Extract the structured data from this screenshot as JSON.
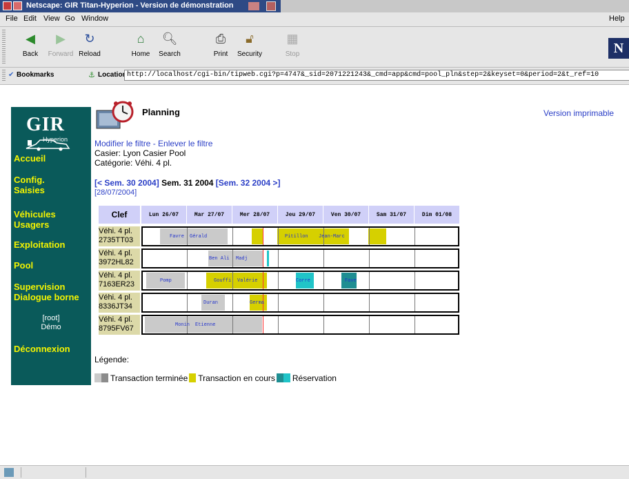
{
  "window": {
    "title": "Netscape: GIR Titan-Hyperion - Version de démonstration"
  },
  "menu": {
    "items": [
      "File",
      "Edit",
      "View",
      "Go",
      "Window"
    ],
    "help": "Help"
  },
  "toolbar": {
    "back": "Back",
    "forward": "Forward",
    "reload": "Reload",
    "home": "Home",
    "search": "Search",
    "print": "Print",
    "security": "Security",
    "stop": "Stop"
  },
  "location": {
    "bookmarks": "Bookmarks",
    "label": "Location:",
    "url": "http://localhost/cgi-bin/tipweb.cgi?p=4747&_sid=2071221243&_cmd=app&cmd=pool_pln&step=2&keyset=0&period=2&t_ref=10"
  },
  "sidebar": {
    "logo": "GIR",
    "logo_sub": "Hyperion",
    "nav": [
      "Accueil",
      "Config.\nSaisies",
      "Véhicules\nUsagers",
      "Exploitation",
      "Pool",
      "Supervision\nDialogue borne",
      "Déconnexion"
    ],
    "user_line1": "[root]",
    "user_line2": "Démo"
  },
  "page": {
    "title": "Planning",
    "print_version": "Version imprimable",
    "modify_filter": "Modifier le filtre",
    "separator": " - ",
    "remove_filter": "Enlever le filtre",
    "casier": "Casier: Lyon Casier Pool",
    "categorie": "Catégorie: Véhi. 4 pl.",
    "prev_week": "[< Sem. 30 2004]",
    "current_week": " Sem. 31 2004 ",
    "next_week": "[Sem. 32 2004 >]",
    "date": "[28/07/2004]"
  },
  "grid": {
    "clef": "Clef",
    "days": [
      "Lun 26/07",
      "Mar 27/07",
      "Mer 28/07",
      "Jeu 29/07",
      "Ven 30/07",
      "Sam 31/07",
      "Dim 01/08"
    ],
    "rows": [
      {
        "vehicle": "Véhi. 4 pl.\n2735TT03"
      },
      {
        "vehicle": "Véhi. 4 pl.\n3972HL82"
      },
      {
        "vehicle": "Véhi. 4 pl.\n7163ER23"
      },
      {
        "vehicle": "Véhi. 4 pl.\n8336JT34"
      },
      {
        "vehicle": "Véhi. 4 pl.\n8795FV67"
      }
    ],
    "labels": {
      "r0": [
        "Favre",
        "Gérald",
        "Pitillon",
        "Jean-Marc"
      ],
      "r1": [
        "Ben Ali",
        "Madj"
      ],
      "r2": [
        "Pomp",
        "Gouffi",
        "Valérie",
        "Corre",
        "Fave"
      ],
      "r3": [
        "Duran",
        "Germa"
      ],
      "r4": [
        "Monin",
        "Etienne"
      ]
    }
  },
  "legend": {
    "title": "Légende:",
    "done": "Transaction terminée",
    "in_progress": "Transaction en cours",
    "reservation": "Réservation",
    "colors": {
      "done": "#cacaca",
      "done_dark": "#8c8c8c",
      "in_progress": "#d6d000",
      "reservation": "#20c4c8",
      "reservation_dark": "#1e8e92"
    }
  }
}
